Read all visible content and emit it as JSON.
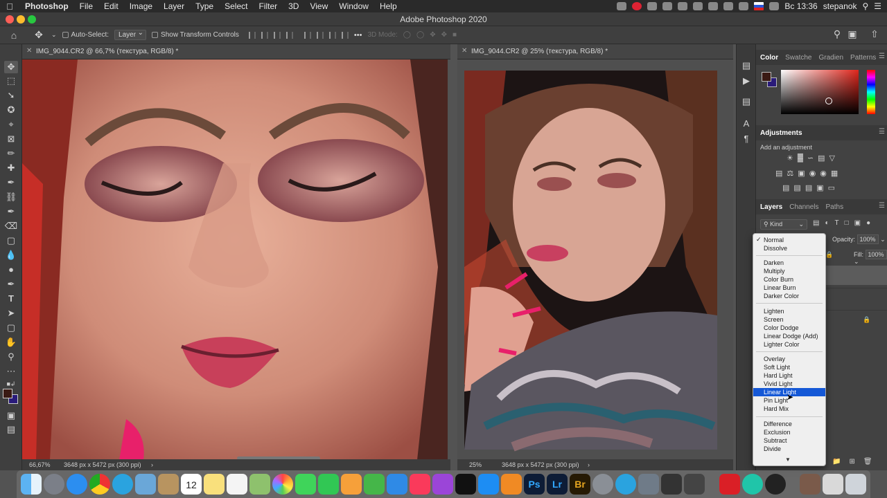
{
  "menubar": {
    "app_name": "Photoshop",
    "items": [
      "File",
      "Edit",
      "Image",
      "Layer",
      "Type",
      "Select",
      "Filter",
      "3D",
      "View",
      "Window",
      "Help"
    ],
    "clock": "Вс 13:36",
    "user": "stepanok"
  },
  "window": {
    "title": "Adobe Photoshop 2020"
  },
  "options_bar": {
    "auto_select_label": "Auto-Select:",
    "auto_select_value": "Layer",
    "show_transform_label": "Show Transform Controls",
    "three_d_mode_label": "3D Mode:",
    "more_label": "•••"
  },
  "documents": [
    {
      "tab_title": "IMG_9044.CR2 @ 66,7% (текстура, RGB/8) *",
      "zoom": "66,67%",
      "doc_info": "3648 px x 5472 px (300 ppi)"
    },
    {
      "tab_title": "IMG_9044.CR2 @ 25% (текстура, RGB/8) *",
      "zoom": "25%",
      "doc_info": "3648 px x 5472 px (300 ppi)"
    }
  ],
  "color_panel": {
    "tabs": [
      "Color",
      "Swatche",
      "Gradien",
      "Patterns"
    ],
    "active_tab": "Color",
    "foreground": "#3a1a14",
    "background": "#2a1b7a"
  },
  "adjustments_panel": {
    "title": "Adjustments",
    "subtitle": "Add an adjustment"
  },
  "layers_panel": {
    "tabs": [
      "Layers",
      "Channels",
      "Paths"
    ],
    "active_tab": "Layers",
    "filter_label": "Kind",
    "opacity_label": "Opacity:",
    "opacity_value": "100%",
    "fill_label": "Fill:",
    "fill_value": "100%"
  },
  "blend_mode_menu": {
    "checked": "Normal",
    "highlighted": "Linear Light",
    "groups": [
      [
        "Normal",
        "Dissolve"
      ],
      [
        "Darken",
        "Multiply",
        "Color Burn",
        "Linear Burn",
        "Darker Color"
      ],
      [
        "Lighten",
        "Screen",
        "Color Dodge",
        "Linear Dodge (Add)",
        "Lighter Color"
      ],
      [
        "Overlay",
        "Soft Light",
        "Hard Light",
        "Vivid Light",
        "Linear Light",
        "Pin Light",
        "Hard Mix"
      ],
      [
        "Difference",
        "Exclusion",
        "Subtract",
        "Divide"
      ]
    ]
  },
  "dock": {
    "calendar_day": "12",
    "apps": [
      "Finder",
      "Launchpad",
      "Safari",
      "Chrome",
      "Telegram",
      "Preview",
      "Contacts",
      "Calendar",
      "Notes",
      "Reminders",
      "Maps",
      "Photos",
      "Messages",
      "FaceTime",
      "Pages",
      "Numbers",
      "Keynote",
      "Music",
      "Podcasts",
      "TV",
      "App Store",
      "Books",
      "Photoshop",
      "Lightroom",
      "Bridge",
      "System Preferences",
      "Telegram",
      "Migration",
      "Final Cut",
      "Downloads",
      "Creative Cloud",
      "Webflow",
      "OBS",
      "Photo Booth",
      "Files",
      "Trash"
    ],
    "ps_label": "Ps",
    "lr_label": "Lr",
    "br_label": "Br"
  }
}
